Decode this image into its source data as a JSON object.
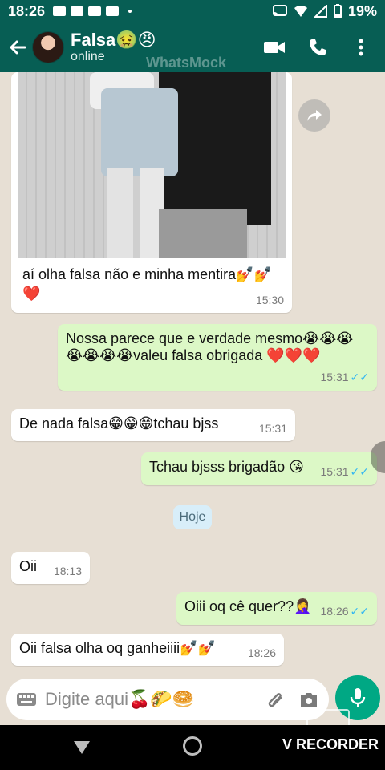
{
  "status_bar": {
    "time": "18:26",
    "battery": "19%"
  },
  "app_bar": {
    "contact_name": "Falsa🤢😠",
    "status": "online",
    "watermark": "WhatsMock"
  },
  "chat": {
    "photo_message": {
      "caption": "aí olha falsa não e minha mentira💅💅❤️",
      "time": "15:30"
    },
    "messages": [
      {
        "dir": "out",
        "text": "Nossa parece que e verdade mesmo😭😭😭😭😭😭😭valeu falsa obrigada ❤️❤️❤️",
        "time": "15:31"
      },
      {
        "dir": "in",
        "text": "De nada falsa😁😁😁tchau bjss",
        "time": "15:31"
      },
      {
        "dir": "out",
        "text": "Tchau bjsss brigadão 😘",
        "time": "15:31"
      },
      {
        "dir": "in",
        "text": "Oii",
        "time": "18:13"
      },
      {
        "dir": "out",
        "text": "Oiii oq cê quer??🤦‍♀️",
        "time": "18:26"
      },
      {
        "dir": "in",
        "text": "Oii falsa olha oq ganheiiii💅💅",
        "time": "18:26"
      }
    ],
    "date_divider": "Hoje"
  },
  "input": {
    "placeholder": "Digite aqui🍒🌮🥯"
  },
  "nav": {
    "recorder_label": "V RECORDER"
  },
  "colors": {
    "header": "#075e54",
    "outgoing_bubble": "#dcf8c6",
    "incoming_bubble": "#ffffff",
    "chat_background": "#e7dfd4",
    "accent": "#00a884",
    "read_ticks": "#34b7f1"
  }
}
